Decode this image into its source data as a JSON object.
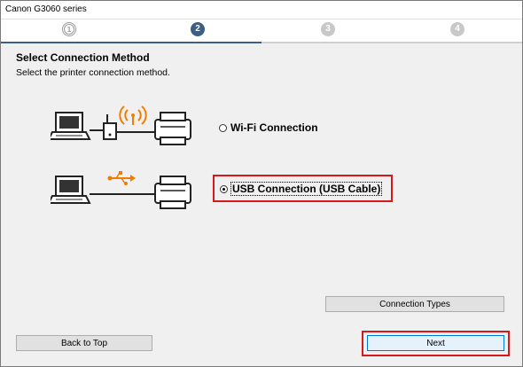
{
  "window": {
    "title": "Canon G3060 series"
  },
  "steps": [
    {
      "label": "1",
      "state": "done"
    },
    {
      "label": "2",
      "state": "current"
    },
    {
      "label": "3",
      "state": "pending"
    },
    {
      "label": "4",
      "state": "pending"
    }
  ],
  "page": {
    "heading": "Select Connection Method",
    "subheading": "Select the printer connection method."
  },
  "options": {
    "wifi": {
      "label": "Wi-Fi Connection",
      "selected": false,
      "icon": "wifi-signal-icon"
    },
    "usb": {
      "label": "USB Connection (USB Cable)",
      "selected": true,
      "icon": "usb-icon"
    }
  },
  "buttons": {
    "connection_types": "Connection Types",
    "back_to_top": "Back to Top",
    "next": "Next"
  },
  "colors": {
    "accent": "#3d5f86",
    "highlight": "#d7191c",
    "signal": "#f07c00"
  }
}
